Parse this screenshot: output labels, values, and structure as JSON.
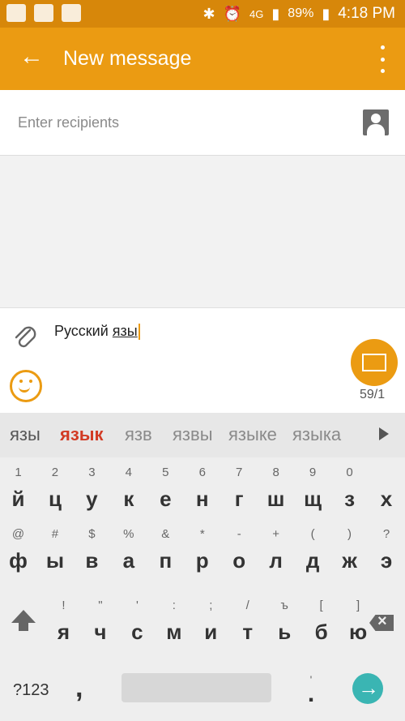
{
  "status": {
    "network": "4G",
    "battery": "89%",
    "time": "4:18 PM"
  },
  "appbar": {
    "title": "New message"
  },
  "recipients": {
    "placeholder": "Enter recipients"
  },
  "compose": {
    "text_plain": "Русский ",
    "text_underlined": "язы",
    "counter": "59/1"
  },
  "suggestions": [
    "язы",
    "язык",
    "язв",
    "язвы",
    "языке",
    "языка"
  ],
  "keyboard": {
    "row1": [
      {
        "sup": "1",
        "key": "й"
      },
      {
        "sup": "2",
        "key": "ц"
      },
      {
        "sup": "3",
        "key": "у"
      },
      {
        "sup": "4",
        "key": "к"
      },
      {
        "sup": "5",
        "key": "е"
      },
      {
        "sup": "6",
        "key": "н"
      },
      {
        "sup": "7",
        "key": "г"
      },
      {
        "sup": "8",
        "key": "ш"
      },
      {
        "sup": "9",
        "key": "щ"
      },
      {
        "sup": "0",
        "key": "з"
      },
      {
        "sup": "",
        "key": "х"
      }
    ],
    "row2": [
      {
        "sup": "@",
        "key": "ф"
      },
      {
        "sup": "#",
        "key": "ы"
      },
      {
        "sup": "$",
        "key": "в"
      },
      {
        "sup": "%",
        "key": "а"
      },
      {
        "sup": "&",
        "key": "п"
      },
      {
        "sup": "*",
        "key": "р"
      },
      {
        "sup": "-",
        "key": "о"
      },
      {
        "sup": "+",
        "key": "л"
      },
      {
        "sup": "(",
        "key": "д"
      },
      {
        "sup": ")",
        "key": "ж"
      },
      {
        "sup": "?",
        "key": "э"
      }
    ],
    "row3": [
      {
        "sup": "!",
        "key": "я"
      },
      {
        "sup": "\"",
        "key": "ч"
      },
      {
        "sup": "'",
        "key": "с"
      },
      {
        "sup": ":",
        "key": "м"
      },
      {
        "sup": ";",
        "key": "и"
      },
      {
        "sup": "/",
        "key": "т"
      },
      {
        "sup": "ъ",
        "key": "ь"
      },
      {
        "sup": "[",
        "key": "б"
      },
      {
        "sup": "]",
        "key": "ю"
      }
    ],
    "symbols_label": "?123",
    "comma": ",",
    "period_sup": "'",
    "period": "."
  }
}
